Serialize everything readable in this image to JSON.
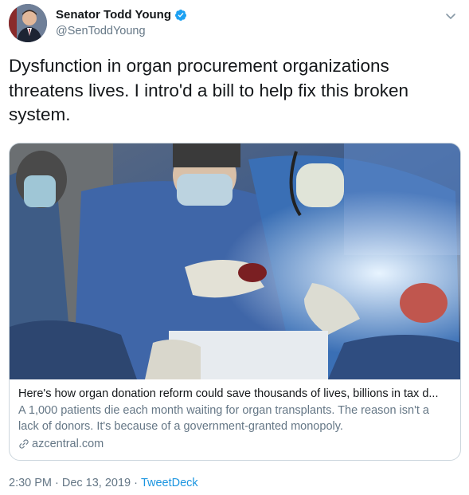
{
  "author": {
    "display_name": "Senator Todd Young",
    "handle": "@SenToddYoung",
    "verified": true
  },
  "tweet": {
    "text": "Dysfunction in organ procurement organizations threatens lives. I intro'd a bill to help fix this broken system."
  },
  "card": {
    "title": "Here's how organ donation reform could save thousands of lives, billions in tax d...",
    "description": "A 1,000 patients die each month waiting for organ transplants. The reason isn't a lack of donors. It's because of a government-granted monopoly.",
    "domain": "azcentral.com"
  },
  "meta": {
    "time": "2:30 PM",
    "date": "Dec 13, 2019",
    "separator": "·",
    "source": "TweetDeck"
  },
  "colors": {
    "verified": "#1da1f2",
    "link": "#1b95e0",
    "secondary_text": "#657786"
  },
  "icons": {
    "verified": "verified-badge-icon",
    "caret": "chevron-down-icon",
    "link": "link-icon"
  }
}
